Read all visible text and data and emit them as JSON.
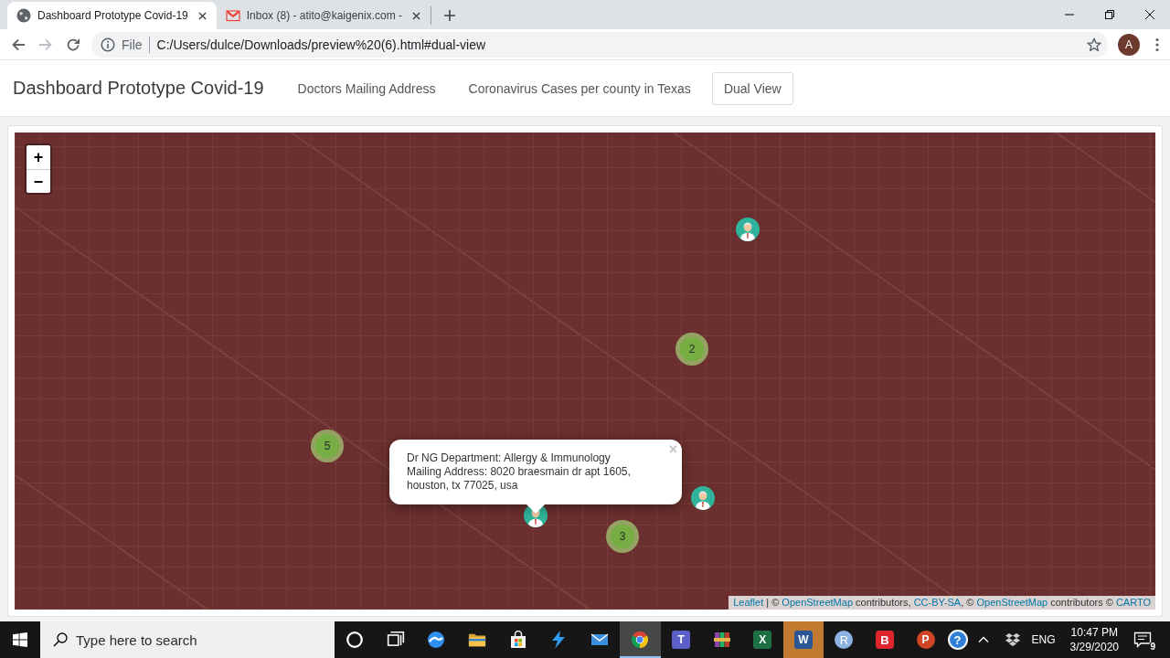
{
  "browser": {
    "tabs": [
      {
        "kind": "page",
        "title": "Dashboard Prototype Covid-19",
        "selected": true
      },
      {
        "kind": "webmail",
        "title": "Inbox (8) - atito@kaigenix.com -",
        "selected": false
      }
    ],
    "history": [
      {
        "kind": "back",
        "disabled": false
      },
      {
        "kind": "forward",
        "disabled": true
      }
    ],
    "address": {
      "scheme_label": "File",
      "url": "C:/Users/dulce/Downloads/preview%20(6).html#dual-view"
    },
    "profile_initial": "A"
  },
  "navbar": {
    "brand": "Dashboard Prototype Covid-19",
    "links": [
      {
        "label": "Doctors Mailing Address",
        "selected": false
      },
      {
        "label": "Coronavirus Cases per county in Texas",
        "selected": false
      },
      {
        "label": "Dual View",
        "selected": true
      }
    ]
  },
  "map": {
    "zoom_controls": [
      "+",
      "−"
    ],
    "markers": [
      {
        "kind": "doctor"
      },
      {
        "kind": "doctor"
      },
      {
        "kind": "doctor"
      }
    ],
    "clusters": [
      {
        "count": "2"
      },
      {
        "count": "5"
      },
      {
        "count": "3"
      }
    ],
    "popup": {
      "lines": [
        "Dr NG Department: Allergy & Immunology",
        "Mailing Address: 8020 braesmain dr apt 1605, houston, tx 77025, usa"
      ],
      "close": "×"
    },
    "attribution": [
      {
        "kind": "link",
        "text": "Leaflet"
      },
      {
        "kind": "text",
        "text": " | © "
      },
      {
        "kind": "link",
        "text": "OpenStreetMap"
      },
      {
        "kind": "text",
        "text": " contributors, "
      },
      {
        "kind": "link",
        "text": "CC-BY-SA"
      },
      {
        "kind": "text",
        "text": ", © "
      },
      {
        "kind": "link",
        "text": "OpenStreetMap"
      },
      {
        "kind": "text",
        "text": " contributors © "
      },
      {
        "kind": "link",
        "text": "CARTO"
      }
    ]
  },
  "taskbar": {
    "search": {
      "placeholder": "Type here to search"
    },
    "apps": [
      {
        "kind": "cortana",
        "selected": false,
        "flashing": false
      },
      {
        "kind": "task-view",
        "selected": false,
        "flashing": false
      },
      {
        "kind": "edge",
        "selected": false,
        "flashing": false
      },
      {
        "kind": "explorer",
        "selected": false,
        "flashing": false
      },
      {
        "kind": "store",
        "selected": false,
        "flashing": false
      },
      {
        "kind": "bolt",
        "selected": false,
        "flashing": false
      },
      {
        "kind": "mail",
        "selected": false,
        "flashing": false
      },
      {
        "kind": "chrome",
        "selected": true,
        "flashing": false
      },
      {
        "kind": "teams",
        "label": "T",
        "selected": false,
        "flashing": false
      },
      {
        "kind": "archiver",
        "selected": false,
        "flashing": false
      },
      {
        "kind": "excel",
        "label": "X",
        "selected": false,
        "flashing": false
      },
      {
        "kind": "word",
        "label": "W",
        "selected": false,
        "flashing": true
      },
      {
        "kind": "round-letter",
        "label": "R",
        "selected": false,
        "flashing": false
      },
      {
        "kind": "square-letter",
        "label": "B",
        "selected": false,
        "flashing": false
      },
      {
        "kind": "powerpoint",
        "label": "P",
        "selected": false,
        "flashing": false
      }
    ],
    "tray": {
      "help": "?",
      "language": "ENG",
      "time": "10:47 PM",
      "date": "3/29/2020",
      "notifications": "9"
    }
  }
}
